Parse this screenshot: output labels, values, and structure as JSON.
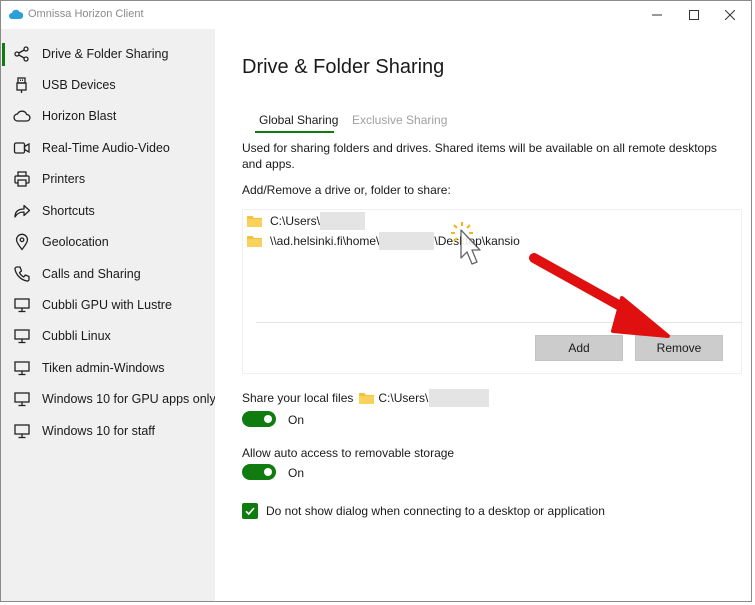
{
  "window": {
    "title": "Omnissa Horizon Client",
    "minimize": "—",
    "maximize": "☐",
    "close": "✕"
  },
  "sidebar": {
    "items": [
      {
        "label": "Drive & Folder Sharing",
        "icon": "share-icon",
        "active": true
      },
      {
        "label": "USB Devices",
        "icon": "usb-icon"
      },
      {
        "label": "Horizon Blast",
        "icon": "cloud-icon"
      },
      {
        "label": "Real-Time Audio-Video",
        "icon": "camera-icon"
      },
      {
        "label": "Printers",
        "icon": "printer-icon"
      },
      {
        "label": "Shortcuts",
        "icon": "shortcut-arrow-icon"
      },
      {
        "label": "Geolocation",
        "icon": "location-pin-icon"
      },
      {
        "label": "Calls and Sharing",
        "icon": "phone-icon"
      },
      {
        "label": "Cubbli GPU with Lustre",
        "icon": "monitor-icon"
      },
      {
        "label": "Cubbli Linux",
        "icon": "monitor-icon"
      },
      {
        "label": "Tiken admin-Windows",
        "icon": "monitor-icon"
      },
      {
        "label": "Windows 10 for GPU apps only",
        "icon": "monitor-icon"
      },
      {
        "label": "Windows 10 for staff",
        "icon": "monitor-icon"
      }
    ]
  },
  "main": {
    "title": "Drive & Folder Sharing",
    "tabs": [
      {
        "label": "Global Sharing",
        "active": true
      },
      {
        "label": "Exclusive Sharing",
        "active": false
      }
    ],
    "description": "Used for sharing folders and drives. Shared items will be available on all remote desktops and apps.",
    "add_remove_label": "Add/Remove a drive or, folder to share:",
    "shared_items": [
      {
        "prefix": "C:\\Users\\",
        "suffix": ""
      },
      {
        "prefix": "\\\\ad.helsinki.fi\\home\\",
        "suffix": "\\Desktop\\kansio"
      }
    ],
    "add_button": "Add",
    "remove_button": "Remove",
    "share_local_label": "Share your local files",
    "share_local_path": "C:\\Users\\",
    "share_local_state": "On",
    "auto_access_label": "Allow auto access to removable storage",
    "auto_access_state": "On",
    "dont_show_dialog_label": "Do not show dialog when connecting to a desktop or application"
  },
  "colors": {
    "accent": "#107c10",
    "arrow": "#e01010",
    "folder": "#f4c238"
  }
}
